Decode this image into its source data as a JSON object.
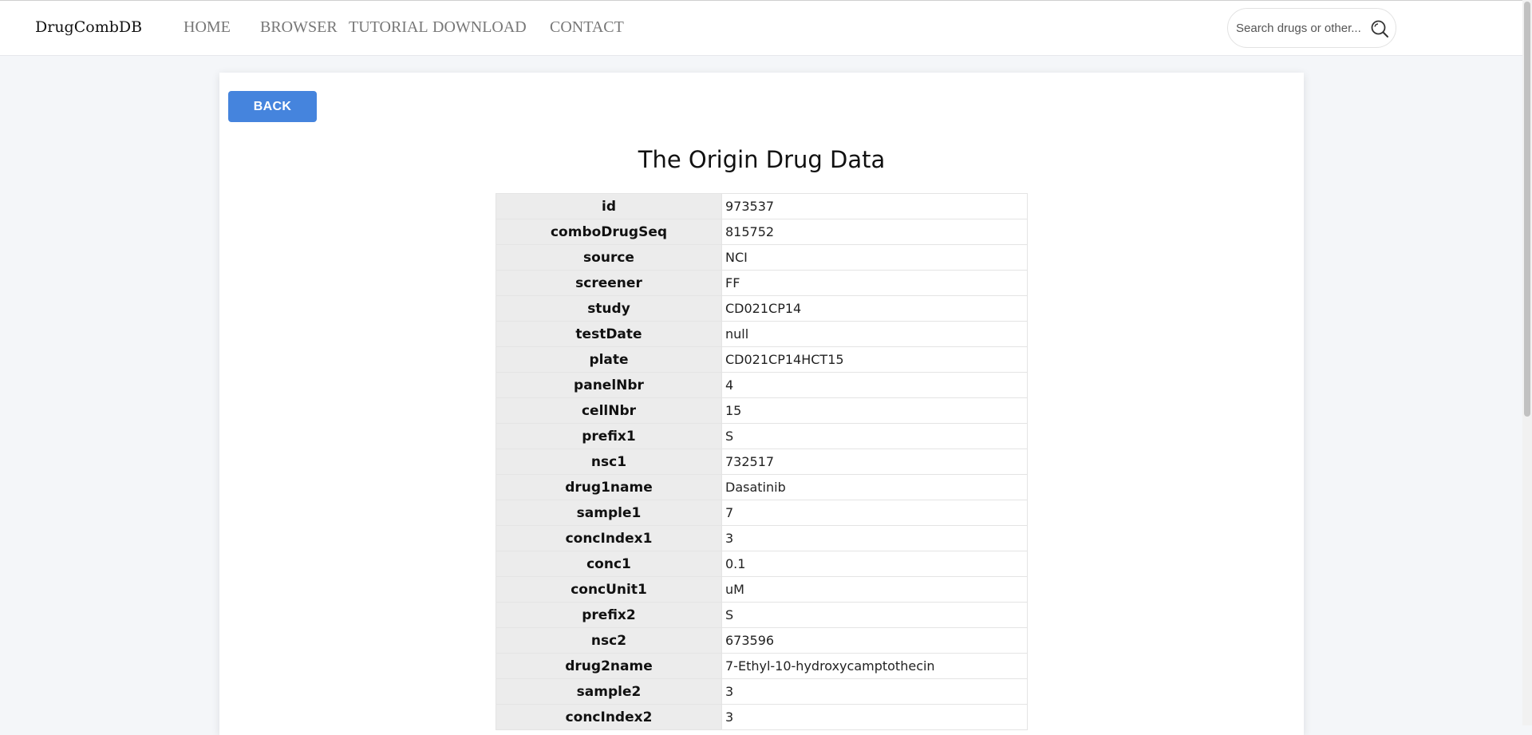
{
  "header": {
    "brand": "DrugCombDB",
    "nav": [
      "HOME",
      "BROWSER",
      "TUTORIAL",
      "DOWNLOAD",
      "CONTACT"
    ],
    "search_placeholder": "Search drugs or other...",
    "search_icon": "search-icon"
  },
  "main": {
    "back_label": "BACK",
    "title": "The Origin Drug Data",
    "rows": [
      {
        "key": "id",
        "value": "973537"
      },
      {
        "key": "comboDrugSeq",
        "value": "815752"
      },
      {
        "key": "source",
        "value": "NCI"
      },
      {
        "key": "screener",
        "value": "FF"
      },
      {
        "key": "study",
        "value": "CD021CP14"
      },
      {
        "key": "testDate",
        "value": "null"
      },
      {
        "key": "plate",
        "value": "CD021CP14HCT15"
      },
      {
        "key": "panelNbr",
        "value": "4"
      },
      {
        "key": "cellNbr",
        "value": "15"
      },
      {
        "key": "prefix1",
        "value": "S"
      },
      {
        "key": "nsc1",
        "value": "732517"
      },
      {
        "key": "drug1name",
        "value": "Dasatinib"
      },
      {
        "key": "sample1",
        "value": "7"
      },
      {
        "key": "concIndex1",
        "value": "3"
      },
      {
        "key": "conc1",
        "value": "0.1"
      },
      {
        "key": "concUnit1",
        "value": "uM"
      },
      {
        "key": "prefix2",
        "value": "S"
      },
      {
        "key": "nsc2",
        "value": "673596"
      },
      {
        "key": "drug2name",
        "value": "7-Ethyl-10-hydroxycamptothecin"
      },
      {
        "key": "sample2",
        "value": "3"
      },
      {
        "key": "concIndex2",
        "value": "3"
      }
    ]
  },
  "colors": {
    "accent": "#4584dd",
    "key_cell_bg": "#ececec",
    "page_bg": "#f4f6f9"
  }
}
